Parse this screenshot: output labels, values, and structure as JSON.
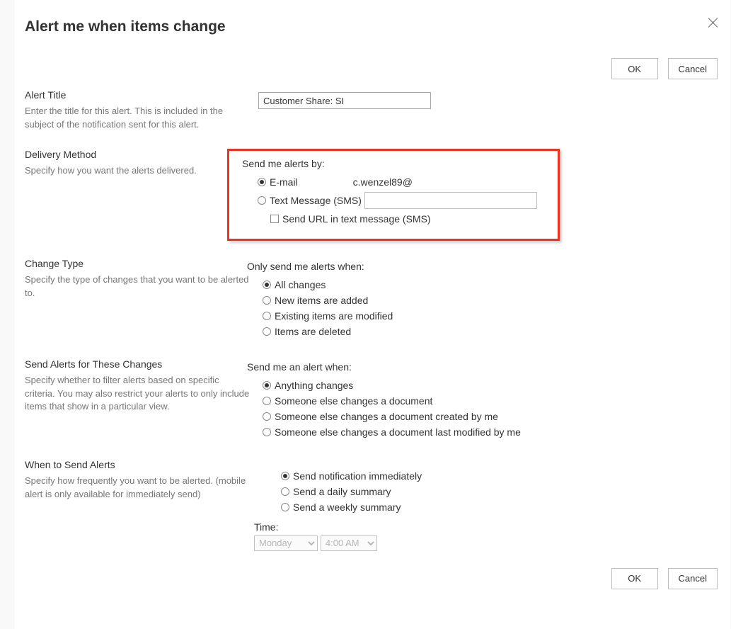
{
  "dialog": {
    "title": "Alert me when items change"
  },
  "buttons": {
    "ok": "OK",
    "cancel": "Cancel"
  },
  "alert_title": {
    "heading": "Alert Title",
    "desc": "Enter the title for this alert. This is included in the subject of the notification sent for this alert.",
    "value": "Customer Share: SI"
  },
  "delivery": {
    "heading": "Delivery Method",
    "desc": "Specify how you want the alerts delivered.",
    "group_label": "Send me alerts by:",
    "email_label": "E-mail",
    "email_value": "c.wenzel89@",
    "sms_label": "Text Message (SMS)",
    "sms_url_label": "Send URL in text message (SMS)"
  },
  "change_type": {
    "heading": "Change Type",
    "desc": "Specify the type of changes that you want to be alerted to.",
    "group_label": "Only send me alerts when:",
    "options": [
      "All changes",
      "New items are added",
      "Existing items are modified",
      "Items are deleted"
    ]
  },
  "filter": {
    "heading": "Send Alerts for These Changes",
    "desc": "Specify whether to filter alerts based on specific criteria. You may also restrict your alerts to only include items that show in a particular view.",
    "group_label": "Send me an alert when:",
    "options": [
      "Anything changes",
      "Someone else changes a document",
      "Someone else changes a document created by me",
      "Someone else changes a document last modified by me"
    ]
  },
  "when": {
    "heading": "When to Send Alerts",
    "desc": "Specify how frequently you want to be alerted. (mobile alert is only available for immediately send)",
    "options": [
      "Send notification immediately",
      "Send a daily summary",
      "Send a weekly summary"
    ],
    "time_label": "Time:",
    "day": "Monday",
    "hour": "4:00 AM"
  }
}
